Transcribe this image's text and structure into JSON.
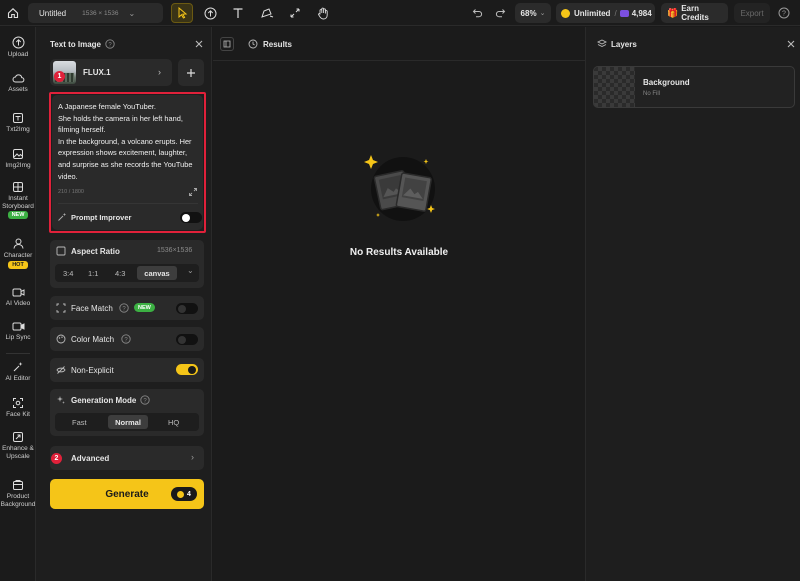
{
  "topbar": {
    "project_name": "Untitled",
    "canvas_size": "1536 × 1536",
    "zoom": "68%",
    "plan": "Unlimited",
    "credits": "4,984",
    "earn_credits": "Earn Credits",
    "export": "Export"
  },
  "rail": {
    "items": [
      {
        "label": "Upload"
      },
      {
        "label": "Assets"
      },
      {
        "label": "Txt2Img"
      },
      {
        "label": "Img2Img"
      },
      {
        "label": "Instant Storyboard",
        "badge": "NEW"
      },
      {
        "label": "Character",
        "badge": "HOT"
      },
      {
        "label": "AI Video"
      },
      {
        "label": "Lip Sync"
      },
      {
        "label": "AI Editor"
      },
      {
        "label": "Face Kit"
      },
      {
        "label": "Enhance & Upscale"
      },
      {
        "label": "Product Background"
      }
    ]
  },
  "panel": {
    "title": "Text to Image",
    "model": "FLUX.1",
    "model_marker": "1",
    "prompt": "A Japanese female YouTuber.\nShe holds the camera in her left hand, filming herself.\nIn the background, a volcano erupts. Her expression shows excitement, laughter, and surprise as she records the YouTube video.",
    "char_count": "210 / 1800",
    "prompt_improver": "Prompt Improver",
    "aspect_ratio": {
      "label": "Aspect Ratio",
      "value": "1536×1536",
      "options": [
        "3:4",
        "1:1",
        "4:3",
        "canvas"
      ],
      "selected": "canvas"
    },
    "face_match": {
      "label": "Face Match",
      "badge": "NEW"
    },
    "color_match": {
      "label": "Color Match"
    },
    "non_explicit": {
      "label": "Non-Explicit"
    },
    "generation_mode": {
      "label": "Generation Mode",
      "options": [
        "Fast",
        "Normal",
        "HQ"
      ],
      "selected": "Normal"
    },
    "advanced": {
      "label": "Advanced",
      "marker": "2"
    },
    "generate": {
      "label": "Generate",
      "cost": "4"
    }
  },
  "results": {
    "title": "Results",
    "empty_text": "No Results Available"
  },
  "layers": {
    "title": "Layers",
    "items": [
      {
        "name": "Background",
        "sub": "No Fill"
      }
    ]
  },
  "colors": {
    "accent_yellow": "#f5c518",
    "highlight_red": "#e0213a",
    "new_badge": "#3cb043",
    "hot_badge": "#f5c518"
  }
}
